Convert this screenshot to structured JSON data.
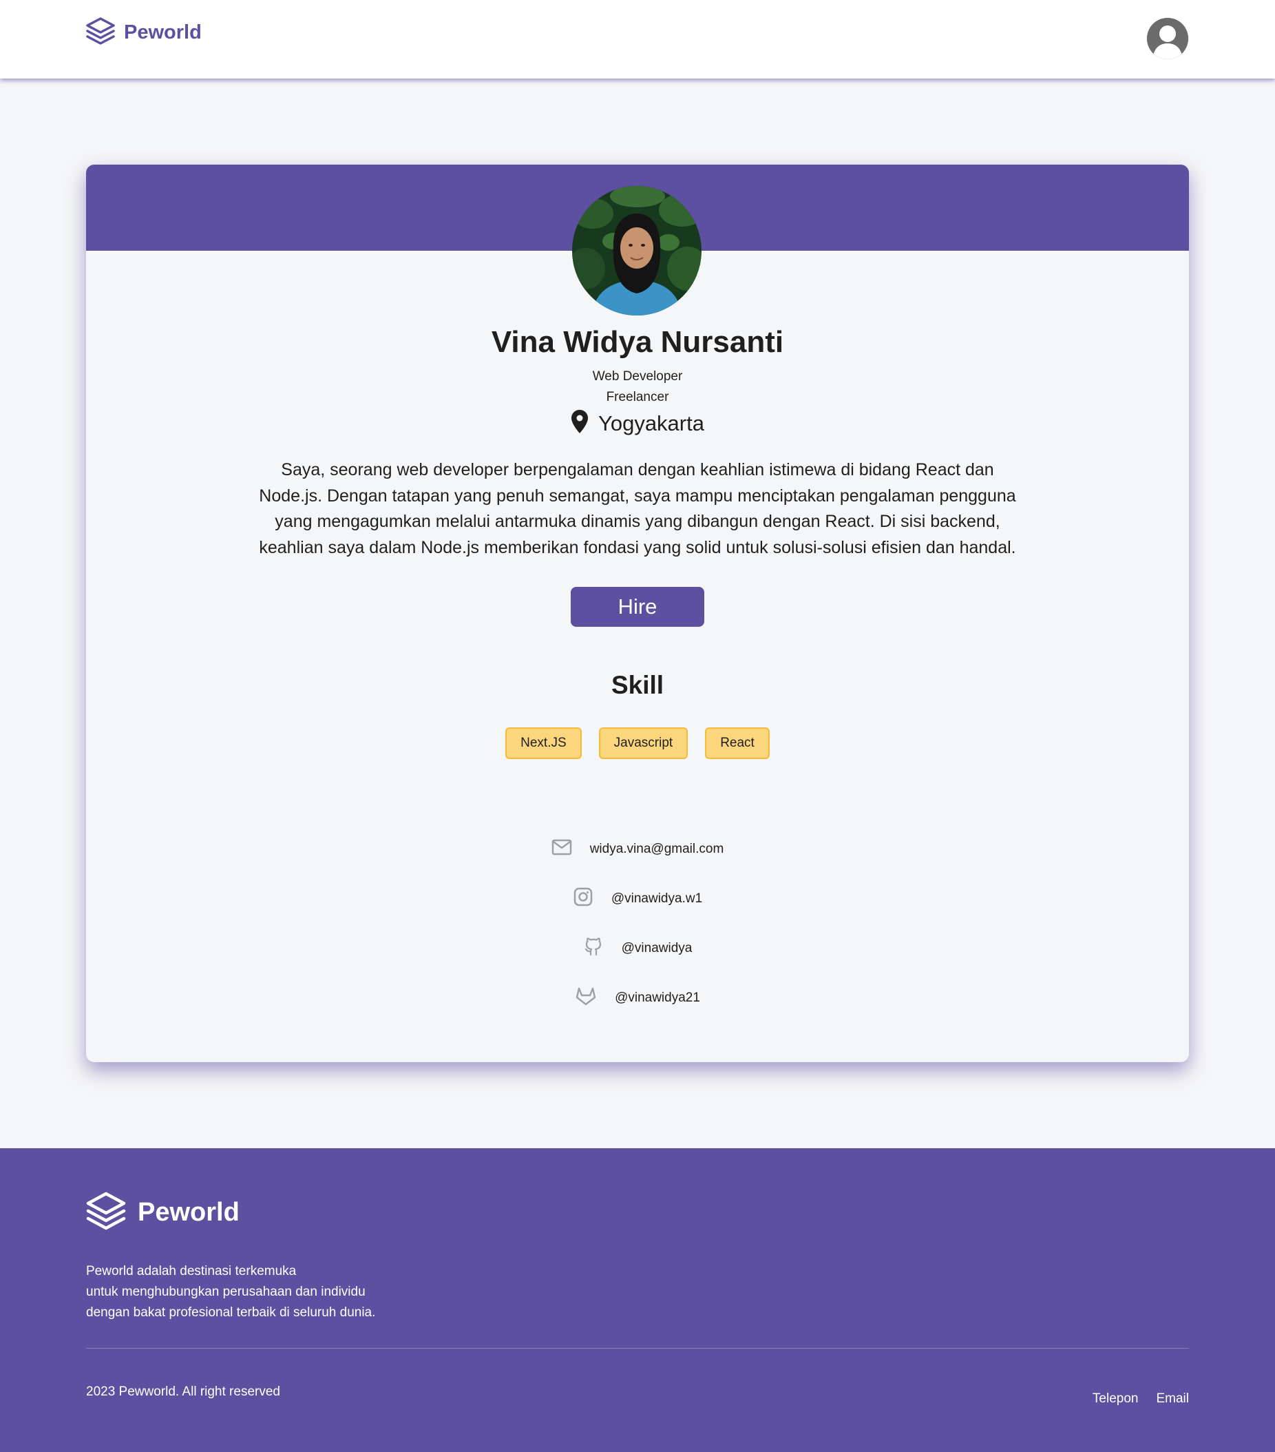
{
  "header": {
    "brand": "Peworld",
    "icons": {
      "logo": "layers-icon",
      "avatar": "user-avatar-icon"
    }
  },
  "profile": {
    "name": "Vina Widya Nursanti",
    "role": "Web Developer",
    "status": "Freelancer",
    "location": "Yogyakarta",
    "bio": "Saya, seorang web developer berpengalaman dengan keahlian istimewa di bidang React dan Node.js. Dengan tatapan yang penuh semangat, saya mampu menciptakan pengalaman pengguna yang mengagumkan melalui antarmuka dinamis yang dibangun dengan React. Di sisi backend, keahlian saya dalam Node.js memberikan fondasi yang solid untuk solusi-solusi efisien dan handal.",
    "hire_label": "Hire",
    "skill_title": "Skill",
    "skills": [
      "Next.JS",
      "Javascript",
      "React"
    ],
    "contacts": [
      {
        "icon": "mail-icon",
        "text": "widya.vina@gmail.com"
      },
      {
        "icon": "instagram-icon",
        "text": "@vinawidya.w1"
      },
      {
        "icon": "github-icon",
        "text": "@vinawidya"
      },
      {
        "icon": "gitlab-icon",
        "text": "@vinawidya21"
      }
    ]
  },
  "footer": {
    "brand": "Peworld",
    "description_lines": [
      "Peworld adalah destinasi terkemuka",
      "untuk menghubungkan perusahaan dan individu",
      "dengan bakat profesional terbaik di seluruh dunia."
    ],
    "copyright": "2023 Pewworld. All right reserved",
    "links": [
      "Telepon",
      "Email"
    ]
  },
  "colors": {
    "primary": "#5e50a1",
    "background": "#f5f6f8",
    "skill_bg": "#fbd67c",
    "skill_border": "#f6b939",
    "icon_gray": "#9ea0a5"
  }
}
